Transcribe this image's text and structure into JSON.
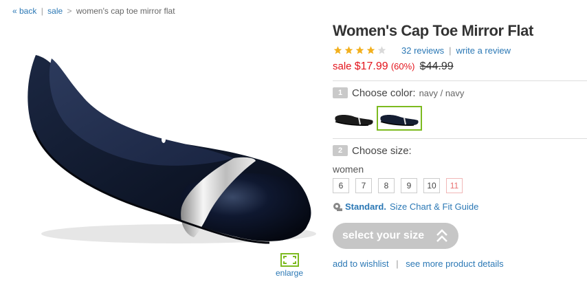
{
  "breadcrumb": {
    "back": "« back",
    "sale": "sale",
    "separator1": "|",
    "separator2": ">",
    "current": "women's cap toe mirror flat"
  },
  "product": {
    "title": "Women's Cap Toe Mirror Flat",
    "rating": {
      "stars": 4,
      "max": 5
    },
    "reviews_link": "32 reviews",
    "pipe": "|",
    "write_review": "write a review",
    "price": {
      "sale_label": "sale",
      "sale_price": "$17.99",
      "discount": "(60%)",
      "original_price": "$44.99"
    }
  },
  "image": {
    "enlarge_label": "enlarge",
    "shoe_icon": "navy-flat-shoe-image"
  },
  "color": {
    "step": "1",
    "label": "Choose color:",
    "value": "navy / navy",
    "swatches": [
      "black-swatch",
      "navy-swatch"
    ],
    "selected": 1
  },
  "size": {
    "step": "2",
    "label": "Choose size:",
    "category": "women",
    "options": [
      "6",
      "7",
      "8",
      "9",
      "10",
      "11"
    ],
    "unavailable": [
      "11"
    ]
  },
  "fit": {
    "icon": "measuring-tape-icon",
    "standard": "Standard.",
    "guide": "Size Chart & Fit Guide"
  },
  "cta": {
    "select_size": "select your size",
    "icon": "double-chevron-up-icon"
  },
  "links": {
    "wishlist": "add to wishlist",
    "pipe": "|",
    "details": "see more product details"
  },
  "colors": {
    "link": "#2b78b5",
    "sale": "#e3141c",
    "accent_green": "#7cba1f",
    "cta_bg": "#c6c6c6",
    "star": "#f2b01e"
  }
}
